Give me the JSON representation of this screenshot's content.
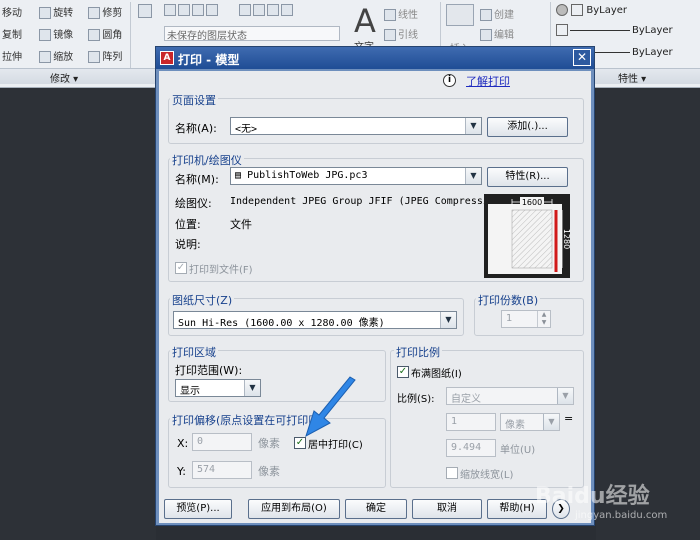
{
  "ribbon": {
    "row1": [
      "移动",
      "旋转",
      "修剪"
    ],
    "row2": [
      "复制",
      "镜像",
      "圆角"
    ],
    "row3": [
      "拉伸",
      "缩放",
      "阵列"
    ],
    "panel_modify": "修改",
    "layer_state": "未保存的图层状态",
    "text_big": "文字",
    "linear": "线性",
    "leader": "引线",
    "insert": "插入",
    "create": "创建",
    "edit": "编辑",
    "bylayer": [
      "ByLayer",
      "ByLayer",
      "ByLayer"
    ],
    "panel_props": "特性"
  },
  "dialog": {
    "title": "打印 - 模型",
    "help_link": "了解打印",
    "page_setup": {
      "group": "页面设置",
      "name_label": "名称(A):",
      "name_value": "<无>",
      "add_button": "添加(.)..."
    },
    "printer": {
      "group": "打印机/绘图仪",
      "name_label": "名称(M):",
      "name_value": "PublishToWeb JPG.pc3",
      "props_button": "特性(R)...",
      "plotter_label": "绘图仪:",
      "plotter_value": "Independent JPEG Group JFIF (JPEG Compressi...",
      "location_label": "位置:",
      "location_value": "文件",
      "desc_label": "说明:",
      "print_to_file": "打印到文件(F)",
      "preview_width": "1600",
      "preview_height": "1280"
    },
    "paper": {
      "group": "图纸尺寸(Z)",
      "value": "Sun Hi-Res (1600.00 x 1280.00 像素)"
    },
    "copies": {
      "group": "打印份数(B)",
      "value": "1"
    },
    "area": {
      "group": "打印区域",
      "range_label": "打印范围(W):",
      "range_value": "显示"
    },
    "offset": {
      "group": "打印偏移(原点设置在可打印区",
      "x_label": "X:",
      "x_value": "0",
      "y_label": "Y:",
      "y_value": "574",
      "unit": "像素",
      "center_label": "居中打印(C)",
      "center_checked": true
    },
    "scale": {
      "group": "打印比例",
      "fit_label": "布满图纸(I)",
      "fit_checked": true,
      "scale_label": "比例(S):",
      "scale_value": "自定义",
      "num1": "1",
      "unit1": "像素",
      "num2": "9.494",
      "unit2": "单位(U)",
      "lineweight": "缩放线宽(L)"
    },
    "buttons": {
      "preview": "预览(P)...",
      "apply": "应用到布局(O)",
      "ok": "确定",
      "cancel": "取消",
      "help": "帮助(H)"
    }
  },
  "watermark": {
    "brand": "Baidu经验",
    "url": "jingyan.baidu.com"
  },
  "colors": {
    "title_bar": "#2b5aa3",
    "group_label": "#16408c",
    "annotation_arrow": "#2f86e6",
    "preview_marker": "#d11a1a"
  }
}
